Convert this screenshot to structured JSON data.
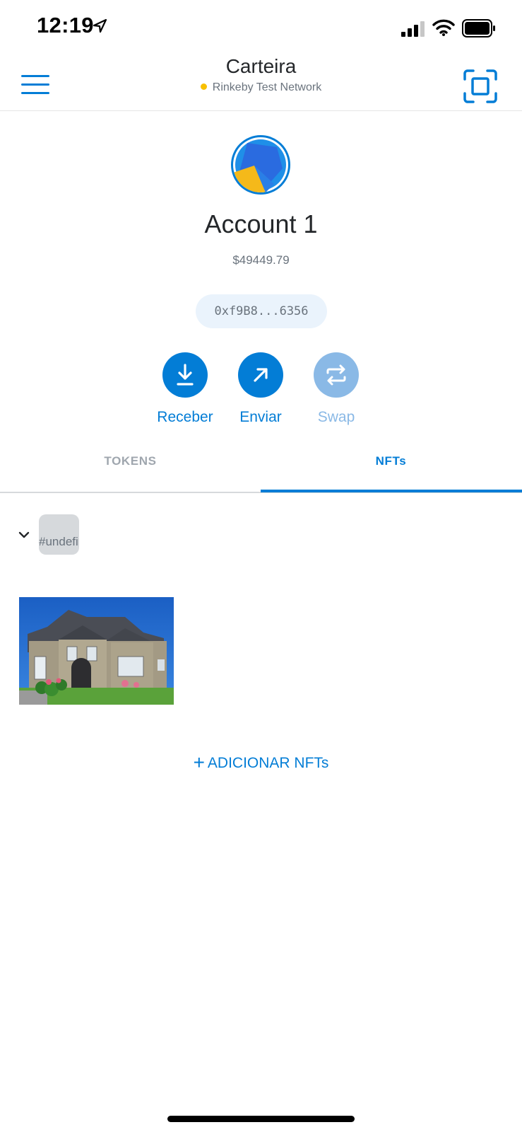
{
  "status_bar": {
    "time": "12:19"
  },
  "header": {
    "title": "Carteira",
    "network": "Rinkeby Test Network",
    "network_dot_color": "#f8c000"
  },
  "account": {
    "name": "Account 1",
    "fiat_balance": "$49449.79",
    "address_short": "0xf9B8...6356"
  },
  "actions": {
    "receive": "Receber",
    "send": "Enviar",
    "swap": "Swap"
  },
  "tabs": {
    "tokens": "TOKENS",
    "nfts": "NFTs",
    "active": "NFTs"
  },
  "nft_collection": {
    "name": "#undefined",
    "expanded": true
  },
  "add_nfts_label": "ADICIONAR NFTs",
  "colors": {
    "accent": "#037dd6",
    "disabled_accent": "#8ab9e6",
    "text_muted": "#6a737d"
  },
  "icons": [
    "location-arrow-icon",
    "cellular-signal-icon",
    "wifi-icon",
    "battery-icon",
    "hamburger-menu-icon",
    "qr-scan-icon",
    "receive-download-icon",
    "send-arrow-icon",
    "swap-arrows-icon",
    "chevron-down-icon",
    "plus-icon"
  ]
}
